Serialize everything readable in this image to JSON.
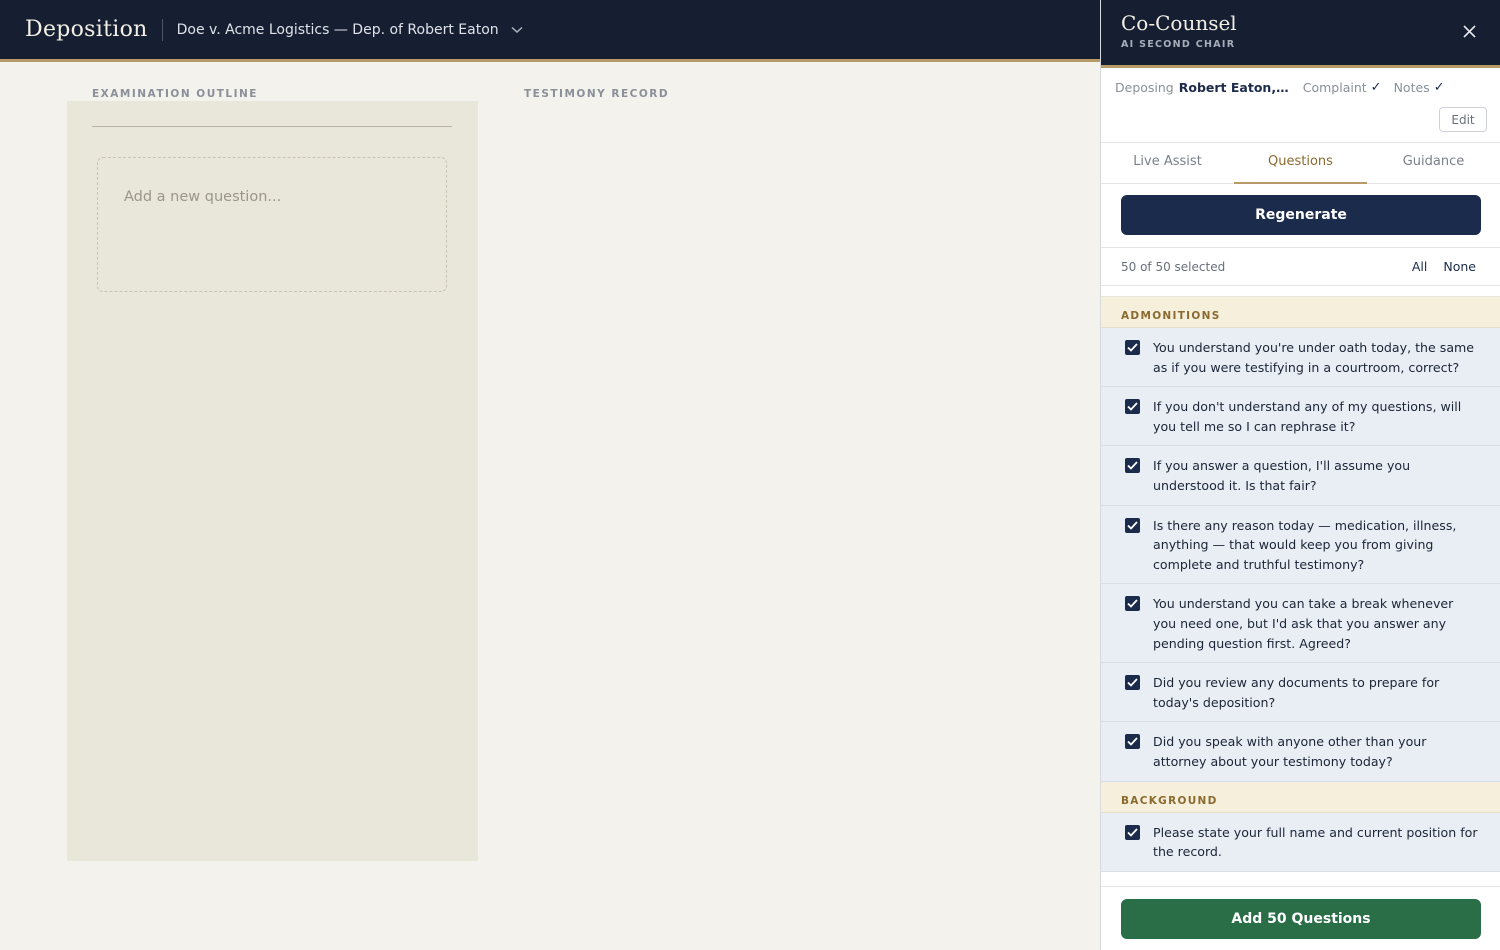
{
  "header": {
    "brand": "Deposition",
    "case_title": "Doe v. Acme Logistics — Dep. of Robert Eaton"
  },
  "main": {
    "outline_label": "EXAMINATION OUTLINE",
    "testimony_label": "TESTIMONY RECORD",
    "new_question_placeholder": "Add a new question..."
  },
  "panel": {
    "title": "Co-Counsel",
    "subtitle": "AI SECOND CHAIR",
    "context": {
      "deposing_label": "Deposing",
      "deposing_name": "Robert Eaton, Dir...",
      "complaint_label": "Complaint",
      "notes_label": "Notes",
      "check": "✓",
      "edit_label": "Edit"
    },
    "tabs": [
      {
        "label": "Live Assist"
      },
      {
        "label": "Questions"
      },
      {
        "label": "Guidance"
      }
    ],
    "regenerate_label": "Regenerate",
    "selection": {
      "count": "50 of 50 selected",
      "all_label": "All",
      "none_label": "None"
    },
    "categories": [
      {
        "name": "ADMONITIONS",
        "questions": [
          "You understand you're under oath today, the same as if you were testifying in a courtroom, correct?",
          "If you don't understand any of my questions, will you tell me so I can rephrase it?",
          "If you answer a question, I'll assume you understood it. Is that fair?",
          "Is there any reason today — medication, illness, anything — that would keep you from giving complete and truthful testimony?",
          "You understand you can take a break whenever you need one, but I'd ask that you answer any pending question first. Agreed?",
          "Did you review any documents to prepare for today's deposition?",
          "Did you speak with anyone other than your attorney about your testimony today?"
        ]
      },
      {
        "name": "BACKGROUND",
        "questions": [
          "Please state your full name and current position for the record."
        ]
      }
    ],
    "add_button_label": "Add 50 Questions"
  },
  "colors": {
    "navy": "#161f32",
    "gold": "#b89a66",
    "button_navy": "#1b2b4b",
    "green": "#2a6e47"
  }
}
